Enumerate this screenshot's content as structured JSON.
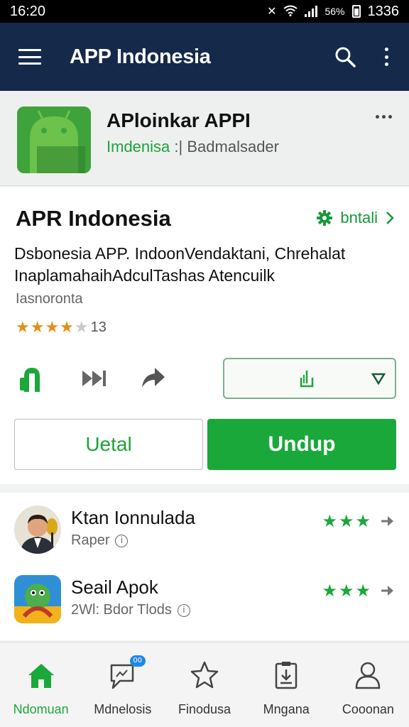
{
  "status_bar": {
    "time_left": "16:20",
    "battery_percent": "56%",
    "time_right": "1336"
  },
  "app_bar": {
    "title": "APP Indonesia",
    "icons": [
      "menu-icon",
      "search-icon",
      "more-vert-icon"
    ]
  },
  "app_header": {
    "name": "APloinkar APPI",
    "category": "Imdenisa",
    "separator": ":|",
    "publisher": "Badmalsader",
    "logo_color": "#3fa33b"
  },
  "detail": {
    "title": "APR Indonesia",
    "install_label": "bntali",
    "description_line1": "Dsbonesia APP. IndoonVendaktani, Chrehalat",
    "description_line2": "InaplamahaihAdculTashas Atencuilk",
    "developer": "Iasnoronta",
    "rating_stars": 4,
    "rating_max": 5,
    "rating_count": "13",
    "star_full": "★★★★",
    "star_empty": "★",
    "actions": [
      "share-icon",
      "skip-icon",
      "forward-icon"
    ],
    "buttons": {
      "secondary": "Uetal",
      "primary": "Undup"
    }
  },
  "related": [
    {
      "name": "Ktan Ionnulada",
      "sub": "Raper",
      "stars": "★★★"
    },
    {
      "name": "Seail Apok",
      "sub": "2Wl: Bdor Tlods",
      "stars": "★★★"
    }
  ],
  "bottom_nav": [
    {
      "label": "Ndomuan",
      "icon": "home-icon",
      "active": true
    },
    {
      "label": "Mdnelosis",
      "icon": "chat-icon",
      "badge": "00"
    },
    {
      "label": "Finodusa",
      "icon": "star-icon"
    },
    {
      "label": "Mngana",
      "icon": "clipboard-icon"
    },
    {
      "label": "Cooonan",
      "icon": "person-icon"
    }
  ],
  "colors": {
    "app_bar": "#15294a",
    "accent_green": "#1aa83a",
    "star_orange": "#e58e16",
    "badge_blue": "#1e88e5"
  }
}
